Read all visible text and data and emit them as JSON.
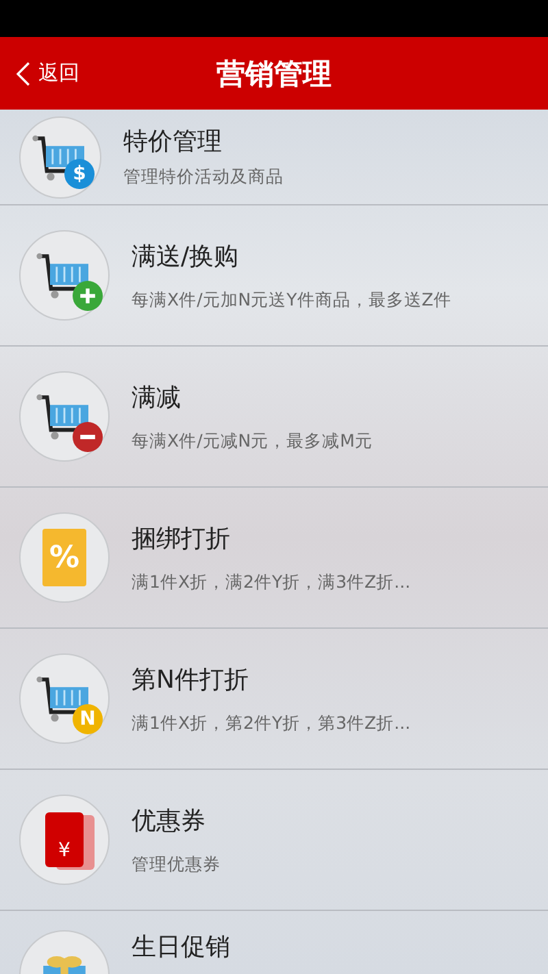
{
  "header": {
    "back": "返回",
    "title": "营销管理"
  },
  "items": [
    {
      "kind": "cart-dollar",
      "badge": "$",
      "title": "特价管理",
      "subtitle": "管理特价活动及商品"
    },
    {
      "kind": "cart-plus",
      "title": "满送/换购",
      "subtitle": "每满X件/元加N元送Y件商品，最多送Z件"
    },
    {
      "kind": "cart-minus",
      "title": "满减",
      "subtitle": "每满X件/元减N元，最多减M元"
    },
    {
      "kind": "bag",
      "badge": "%",
      "title": "捆绑打折",
      "subtitle": "满1件X折，满2件Y折，满3件Z折..."
    },
    {
      "kind": "cart-n",
      "badge": "N",
      "title": "第N件打折",
      "subtitle": "满1件X折，第2件Y折，第3件Z折..."
    },
    {
      "kind": "envelope",
      "badge": "¥",
      "title": "优惠券",
      "subtitle": "管理优惠券"
    },
    {
      "kind": "gift",
      "title": "生日促销"
    }
  ]
}
